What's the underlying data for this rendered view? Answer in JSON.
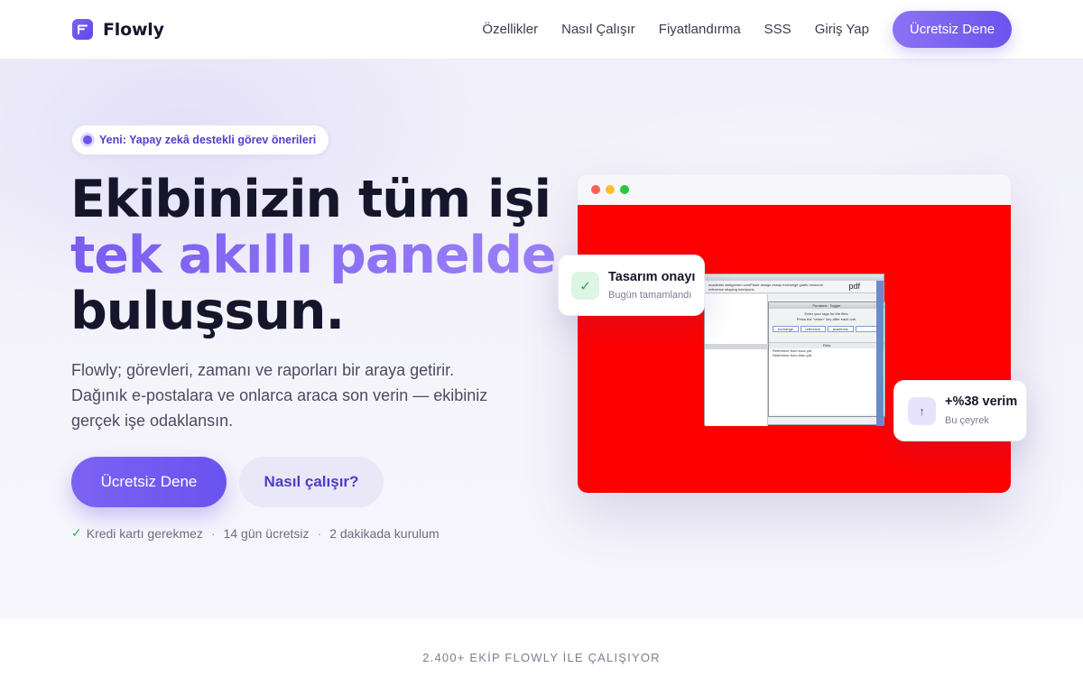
{
  "nav": {
    "brand": "Flowly",
    "links": [
      "Özellikler",
      "Nasıl Çalışır",
      "Fiyatlandırma",
      "SSS",
      "Giriş Yap"
    ],
    "cta": "Ücretsiz Dene"
  },
  "hero": {
    "badge": "Yeni: Yapay zekâ destekli görev önerileri",
    "headline_line1": "Ekibinizin tüm işi",
    "headline_line2": "tek akıllı panelde",
    "headline_line3": "buluşsun.",
    "description": "Flowly; görevleri, zamanı ve raporları bir araya getirir. Dağınık e-postalara ve onlarca araca son verin — ekibiniz gerçek işe odaklansın.",
    "primary_cta": "Ücretsiz Dene",
    "secondary_cta": "Nasıl çalışır?",
    "perks": [
      "Kredi kartı gerekmez",
      "14 gün ücretsiz",
      "2 dakikada kurulum"
    ],
    "perk_separator": "·"
  },
  "mock_window": {
    "embedded_screenshot": {
      "toolbar_line1": "academic assignmen comPaste design essay exchange grafik resource",
      "toolbar_line2": "reference shaping interiporis",
      "pdf_label": "pdf",
      "dialog_title": "Punakea : Tagger",
      "dialog_line1": "Enter your tags for the files.",
      "dialog_line2": "Press the \"return\" key after each one.",
      "tags": [
        "exchange",
        "reference",
        "academic"
      ],
      "files_header": "Files",
      "files": [
        "Reference from boot.pdf",
        "Reference from Alan.pdf"
      ]
    }
  },
  "cards": {
    "approval": {
      "title": "Tasarım onayı",
      "subtitle": "Bugün tamamlandı",
      "icon": "check-icon"
    },
    "efficiency": {
      "title": "+%38 verim",
      "subtitle": "Bu çeyrek",
      "icon": "arrow-up-icon"
    }
  },
  "trust": {
    "text": "2.400+ EKİP FLOWLY İLE ÇALIŞIYOR"
  },
  "colors": {
    "accent": "#6a52ee",
    "accent_light": "#8b73f4",
    "success": "#22b45a",
    "placeholder_red": "#ff0000"
  }
}
